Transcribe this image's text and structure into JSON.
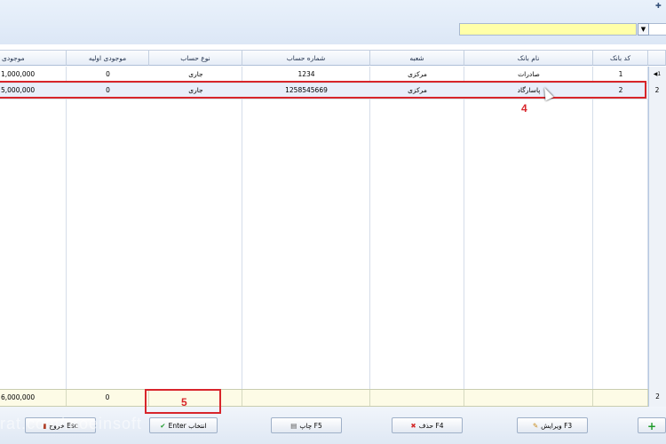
{
  "header": {
    "search_value": "",
    "dropdown_icon": "chevron-down-icon",
    "corner_icon": "plus-icon"
  },
  "grid": {
    "columns": [
      "کد بانک",
      "نام بانک",
      "شعبه",
      "شماره حساب",
      "نوع حساب",
      "موجودی اولیه",
      "موجودی"
    ],
    "rows": [
      {
        "code": "1",
        "bank": "صادرات",
        "branch": "مرکزی",
        "account": "1234",
        "type": "جاری",
        "initial": "0",
        "balance": "1,000,000",
        "indicator": "1"
      },
      {
        "code": "2",
        "bank": "پاسارگاد",
        "branch": "مرکزی",
        "account": "1258545669",
        "type": "جاری",
        "initial": "0",
        "balance": "5,000,000",
        "indicator": "2"
      }
    ],
    "footer": {
      "count": "2",
      "initial_total": "0",
      "balance_total": "6,000,000"
    }
  },
  "annotations": {
    "a4": "4",
    "a5": "5"
  },
  "buttons": {
    "exit": "خروج Esc",
    "select": "Enter انتخاب",
    "print": "چاپ F5",
    "delete": "حذف F4",
    "edit": "ویرایش F3",
    "add": "+"
  },
  "watermark": "rat.com/moeinsoft",
  "colors": {
    "highlight": "#d8252b",
    "search_bg": "#ffffa8",
    "footer_bg": "#fdfbe6"
  }
}
